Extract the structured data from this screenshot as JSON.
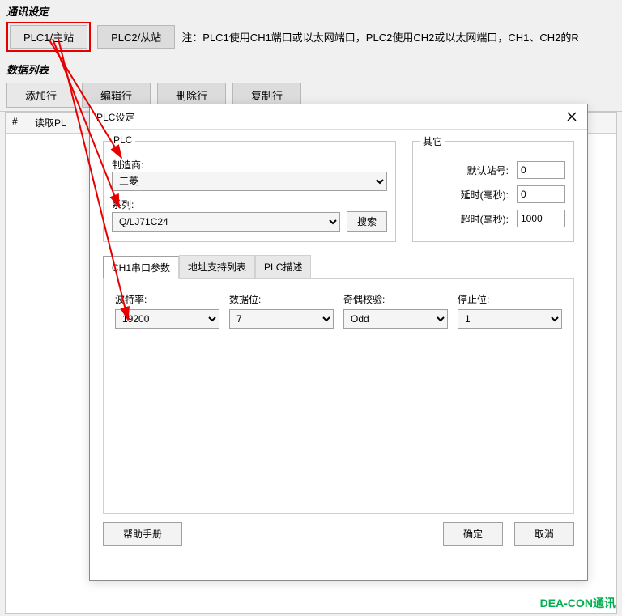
{
  "sections": {
    "comm_settings_title": "通讯设定",
    "data_list_title": "数据列表"
  },
  "plc_tabs": {
    "plc1": "PLC1/主站",
    "plc2": "PLC2/从站",
    "note": "注：PLC1使用CH1端口或以太网端口，PLC2使用CH2或以太网端口，CH1、CH2的R"
  },
  "toolbar": {
    "add": "添加行",
    "edit": "编辑行",
    "delete": "删除行",
    "copy": "复制行"
  },
  "table": {
    "col_index": "#",
    "col_read": "读取PL"
  },
  "dialog": {
    "title": "PLC设定",
    "plc_group": "PLC",
    "other_group": "其它",
    "manufacturer_label": "制造商:",
    "manufacturer_value": "三菱",
    "series_label": "系列:",
    "series_value": "Q/LJ71C24",
    "search_btn": "搜索",
    "default_station_label": "默认站号:",
    "default_station_value": "0",
    "delay_label": "延时(毫秒):",
    "delay_value": "0",
    "timeout_label": "超时(毫秒):",
    "timeout_value": "1000",
    "tabs": {
      "serial": "CH1串口参数",
      "address": "地址支持列表",
      "desc": "PLC描述"
    },
    "serial": {
      "baud_label": "波特率:",
      "baud_value": "19200",
      "databits_label": "数据位:",
      "databits_value": "7",
      "parity_label": "奇偶校验:",
      "parity_value": "Odd",
      "stopbits_label": "停止位:",
      "stopbits_value": "1"
    },
    "help_btn": "帮助手册",
    "ok_btn": "确定",
    "cancel_btn": "取消"
  },
  "watermark": "DEA-CON通讯"
}
